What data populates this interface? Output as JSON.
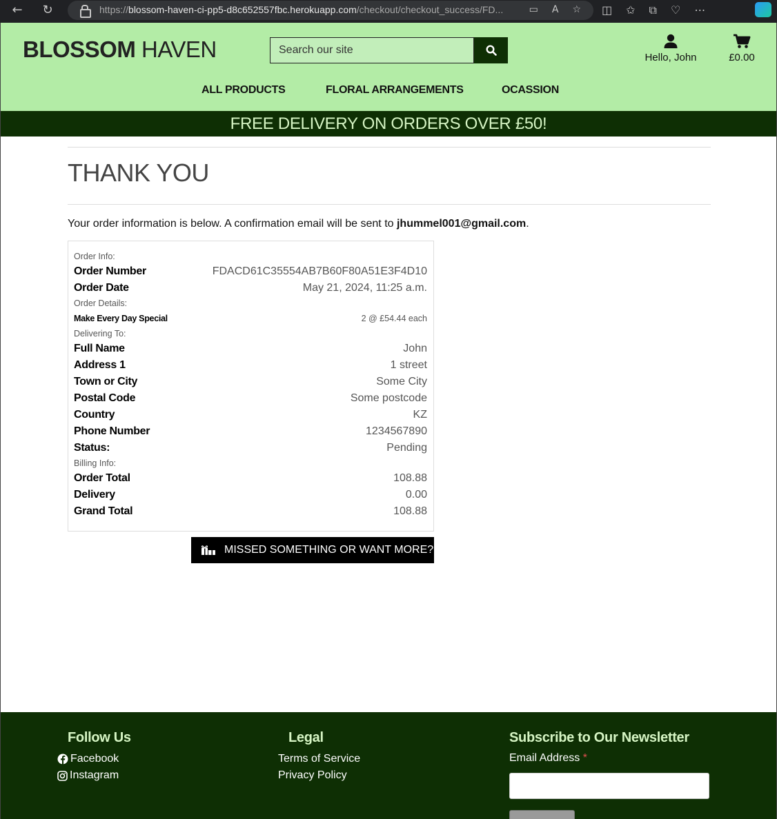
{
  "browser": {
    "url_prefix": "https://",
    "url_host": "blossom-haven-ci-pp5-d8c652557fbc.herokuapp.com",
    "url_path": "/checkout/checkout_success/FD..."
  },
  "header": {
    "logo_bold": "BLOSSOM",
    "logo_rest": " HAVEN",
    "search_placeholder": "Search our site",
    "account_label": "Hello, John",
    "cart_total": "£0.00"
  },
  "nav": {
    "items": [
      {
        "label": "ALL PRODUCTS"
      },
      {
        "label": "FLORAL ARRANGEMENTS"
      },
      {
        "label": "OCASSION"
      }
    ]
  },
  "banner": "FREE DELIVERY ON ORDERS OVER £50!",
  "page": {
    "title": "THANK YOU",
    "intro_text": "Your order information is below. A confirmation email will be sent to ",
    "email": "jhummel001@gmail.com",
    "intro_end": "."
  },
  "order": {
    "section_info": "Order Info:",
    "order_number_label": "Order Number",
    "order_number": "FDACD61C35554AB7B60F80A51E3F4D10",
    "order_date_label": "Order Date",
    "order_date": "May 21, 2024, 11:25 a.m.",
    "section_details": "Order Details:",
    "item_name": "Make Every Day Special",
    "item_qty": "2 @ £54.44 each",
    "section_delivery": "Delivering To:",
    "full_name_label": "Full Name",
    "full_name": "John",
    "address1_label": "Address 1",
    "address1": "1 street",
    "town_label": "Town or City",
    "town": "Some City",
    "postcode_label": "Postal Code",
    "postcode": "Some postcode",
    "country_label": "Country",
    "country": "KZ",
    "phone_label": "Phone Number",
    "phone": "1234567890",
    "status_label": "Status:",
    "status": "Pending",
    "section_billing": "Billing Info:",
    "order_total_label": "Order Total",
    "order_total": "108.88",
    "delivery_label": "Delivery",
    "delivery": "0.00",
    "grand_total_label": "Grand Total",
    "grand_total": "108.88"
  },
  "more_button": "MISSED SOMETHING OR WANT MORE?",
  "footer": {
    "follow_title": "Follow Us",
    "facebook": "Facebook",
    "instagram": "Instagram",
    "legal_title": "Legal",
    "terms": "Terms of Service",
    "privacy": "Privacy Policy",
    "newsletter_title": "Subscribe to Our Newsletter",
    "email_label": "Email Address",
    "required_mark": "*"
  },
  "colors": {
    "header_bg": "#b3eca6",
    "dark_green": "#0e2f04",
    "banner_text": "#d6f5c4"
  }
}
